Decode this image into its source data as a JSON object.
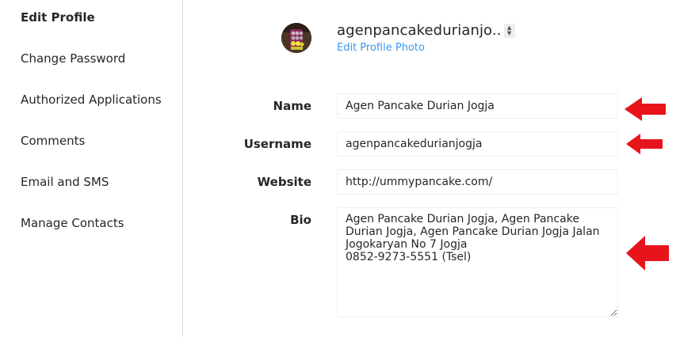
{
  "sidebar": {
    "items": [
      {
        "label": "Edit Profile",
        "active": true
      },
      {
        "label": "Change Password",
        "active": false
      },
      {
        "label": "Authorized Applications",
        "active": false
      },
      {
        "label": "Comments",
        "active": false
      },
      {
        "label": "Email and SMS",
        "active": false
      },
      {
        "label": "Manage Contacts",
        "active": false
      }
    ]
  },
  "profile": {
    "username": "agenpancakedurianjo..",
    "edit_photo_label": "Edit Profile Photo"
  },
  "form": {
    "name_label": "Name",
    "name_value": "Agen Pancake Durian Jogja",
    "username_label": "Username",
    "username_value": "agenpancakedurianjogja",
    "website_label": "Website",
    "website_value": "http://ummypancake.com/",
    "bio_label": "Bio",
    "bio_value": "Agen Pancake Durian Jogja, Agen Pancake Durian Jogja, Agen Pancake Durian Jogja Jalan Jogokaryan No 7 Jogja\n0852-9273-5551 (Tsel)"
  },
  "colors": {
    "link": "#3897f0",
    "arrow": "#e8141c",
    "border": "#efefef",
    "divider": "#dbdbdb"
  },
  "icons": {
    "annotation": "red-arrow-left-icon",
    "switcher": "up-down-chevron-icon"
  }
}
